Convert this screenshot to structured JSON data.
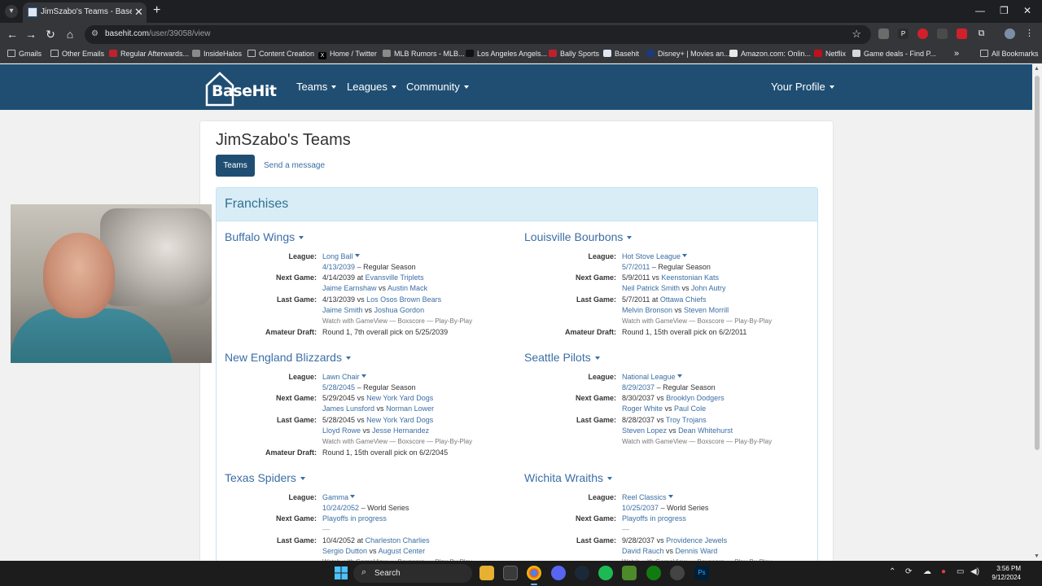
{
  "browser": {
    "tab_title": "JimSzabo's Teams - BaseHit, a b",
    "url_host": "basehit.com",
    "url_path": "/user/39058/view",
    "bookmarks": [
      {
        "label": "Gmails",
        "icon": "folder"
      },
      {
        "label": "Other Emails",
        "icon": "folder"
      },
      {
        "label": "Regular Afterwards...",
        "icon": "site"
      },
      {
        "label": "InsideHalos",
        "icon": "site"
      },
      {
        "label": "Content Creation",
        "icon": "folder"
      },
      {
        "label": "Home / Twitter",
        "icon": "x"
      },
      {
        "label": "MLB Rumors - MLB...",
        "icon": "site"
      },
      {
        "label": "Los Angeles Angels...",
        "icon": "site"
      },
      {
        "label": "Bally Sports",
        "icon": "site"
      },
      {
        "label": "Basehit",
        "icon": "site"
      },
      {
        "label": "Disney+ | Movies an...",
        "icon": "site"
      },
      {
        "label": "Amazon.com: Onlin...",
        "icon": "site"
      },
      {
        "label": "Netflix",
        "icon": "site"
      },
      {
        "label": "Game deals - Find P...",
        "icon": "site"
      }
    ],
    "more_bookmarks": "»",
    "all_bookmarks": "All Bookmarks"
  },
  "site": {
    "logo": "BaseHit",
    "nav": {
      "teams": "Teams",
      "leagues": "Leagues",
      "community": "Community",
      "profile": "Your Profile"
    }
  },
  "page": {
    "title": "JimSzabo's Teams",
    "tab_active": "Teams",
    "tab_message": "Send a message",
    "franchises_title": "Franchises"
  },
  "labels": {
    "league": "League:",
    "next_game": "Next Game:",
    "last_game": "Last Game:",
    "amateur_draft": "Amateur Draft:",
    "watch": "Watch with GameView",
    "boxscore": "Boxscore",
    "pbp": "Play-By-Play"
  },
  "teams": [
    {
      "name": "Buffalo Wings",
      "league": "Long Ball",
      "date": "4/13/2039",
      "season": "– Regular Season",
      "next_date": "4/14/2039",
      "next_sep": "at",
      "next_opp": "Evansville Triplets",
      "next_p1": "Jaime Earnshaw",
      "next_p2": "Austin Mack",
      "last_date": "4/13/2039",
      "last_sep": "vs",
      "last_opp": "Los Osos Brown Bears",
      "last_p1": "Jaime Smith",
      "last_p2": "Joshua Gordon",
      "draft": "Round 1, 7th overall pick on 5/25/2039"
    },
    {
      "name": "Louisville Bourbons",
      "league": "Hot Stove League",
      "date": "5/7/2011",
      "season": "– Regular Season",
      "next_date": "5/9/2011",
      "next_sep": "vs",
      "next_opp": "Keenstonian Kats",
      "next_p1": "Neil Patrick Smith",
      "next_p2": "John Autry",
      "last_date": "5/7/2011",
      "last_sep": "at",
      "last_opp": "Ottawa Chiefs",
      "last_p1": "Melvin Bronson",
      "last_p2": "Steven Morrill",
      "draft": "Round 1, 15th overall pick on 6/2/2011"
    },
    {
      "name": "New England Blizzards",
      "league": "Lawn Chair",
      "date": "5/28/2045",
      "season": "– Regular Season",
      "next_date": "5/29/2045",
      "next_sep": "vs",
      "next_opp": "New York Yard Dogs",
      "next_p1": "James Lunsford",
      "next_p2": "Norman Lower",
      "last_date": "5/28/2045",
      "last_sep": "vs",
      "last_opp": "New York Yard Dogs",
      "last_p1": "Lloyd Rowe",
      "last_p2": "Jesse Hernandez",
      "draft": "Round 1, 15th overall pick on 6/2/2045"
    },
    {
      "name": "Seattle Pilots",
      "league": "National League",
      "date": "8/29/2037",
      "season": "– Regular Season",
      "next_date": "8/30/2037",
      "next_sep": "vs",
      "next_opp": "Brooklyn Dodgers",
      "next_p1": "Roger White",
      "next_p2": "Paul Cole",
      "last_date": "8/28/2037",
      "last_sep": "vs",
      "last_opp": "Troy Trojans",
      "last_p1": "Steven Lopez",
      "last_p2": "Dean Whitehurst",
      "draft": ""
    },
    {
      "name": "Texas Spiders",
      "league": "Gamma",
      "date": "10/24/2052",
      "season": "– World Series",
      "next_text": "Playoffs in progress",
      "next_dash": "—",
      "last_date": "10/4/2052",
      "last_sep": "at",
      "last_opp": "Charleston Charlies",
      "last_p1": "Sergio Dutton",
      "last_p2": "August Center"
    },
    {
      "name": "Wichita Wraiths",
      "league": "Reel Classics",
      "date": "10/25/2037",
      "season": "– World Series",
      "next_text": "Playoffs in progress",
      "next_dash": "—",
      "last_date": "9/28/2037",
      "last_sep": "vs",
      "last_opp": "Providence Jewels",
      "last_p1": "David Rauch",
      "last_p2": "Dennis Ward"
    }
  ],
  "taskbar": {
    "search": "Search",
    "time": "3:56 PM",
    "date": "9/12/2024"
  }
}
